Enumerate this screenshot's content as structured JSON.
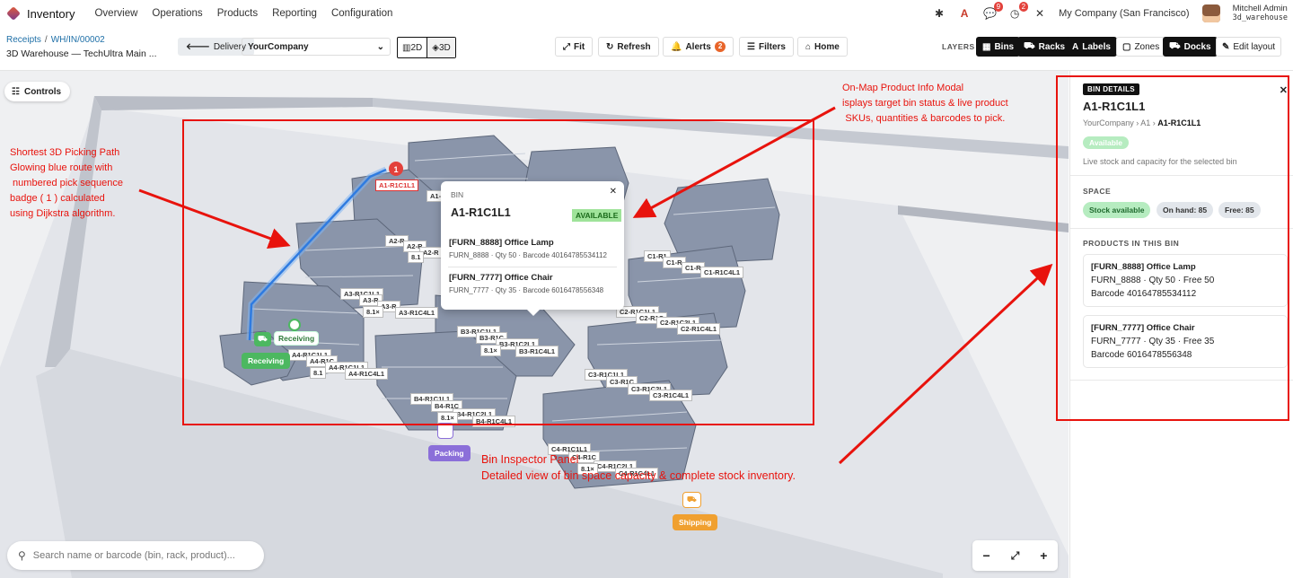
{
  "topbar": {
    "app_name": "Inventory",
    "menu": [
      "Overview",
      "Operations",
      "Products",
      "Reporting",
      "Configuration"
    ],
    "messages_count": "9",
    "activities_count": "2",
    "company": "My Company (San Francisco)",
    "user_name": "Mitchell Admin",
    "database": "3d_warehouse"
  },
  "controlbar": {
    "breadcrumb_parent": "Receipts",
    "breadcrumb_current": "WH/IN/00002",
    "subtitle": "3D Warehouse — TechUltra Main ...",
    "delivery_label": "Delivery",
    "company_select": "YourCompany",
    "view_2d": "2D",
    "view_3d": "3D",
    "fit_label": "Fit",
    "refresh_label": "Refresh",
    "alerts_label": "Alerts",
    "alerts_count": "2",
    "filters_label": "Filters",
    "home_label": "Home",
    "layers_label": "LAYERS",
    "layer_bins": "Bins",
    "layer_racks": "Racks",
    "layer_labels": "Labels",
    "layer_zones": "Zones",
    "layer_docks": "Docks",
    "edit_layout": "Edit layout"
  },
  "canvas": {
    "controls_label": "Controls",
    "search_placeholder": "Search name or barcode (bin, rack, product)...",
    "zoom_out": "−",
    "zoom_fit": "⤢",
    "zoom_in": "+",
    "pick_sequence": "1",
    "highlighted_bin": "A1-R1C1L1",
    "zones": {
      "receiving": "Receiving",
      "packing": "Packing",
      "shipping": "Shipping"
    },
    "rack_labels": {
      "a1_a": "A1-R1C1L1",
      "a1_b": "A1-R",
      "a2_a": "A2-R",
      "a2_b": "A2-R",
      "a2_c": "A2-R",
      "a2_d": "8.1",
      "a3_a": "A3-R1C1L1",
      "a3_b": "A3-R",
      "a3_c": "A3-R",
      "a3_d": "A3-R1C4L1",
      "a3_e": "8.1×",
      "a4_a": "A4-R1C1L1",
      "a4_b": "A4-R1C",
      "a4_c": "A4-R1C1L1",
      "a4_d": "A4-R1C4L1",
      "a4_e": "8.1",
      "b3_a": "B3-R1C1L1",
      "b3_b": "B3-R1C",
      "b3_c": "B3-R1C2L1",
      "b3_d": "B3-R1C4L1",
      "b3_e": "8.1×",
      "b4_a": "B4-R1C1L1",
      "b4_b": "B4-R1C",
      "b4_c": "B4-R1C2L1",
      "b4_d": "B4-R1C4L1",
      "b4_e": "8.1×",
      "c1_a": "C1-R1",
      "c1_b": "C1-R",
      "c1_c": "C1-R",
      "c1_d": "C1-R1C4L1",
      "c2_a": "C2-R1C1L1",
      "c2_b": "C2-R1C",
      "c2_c": "C2-R1C2L1",
      "c2_d": "C2-R1C4L1",
      "c3_a": "C3-R1C1L1",
      "c3_b": "C3-R1C",
      "c3_c": "C3-R1C2L1",
      "c3_d": "C3-R1C4L1",
      "c4_a": "C4-R1C1L1",
      "c4_b": "C4-R1C",
      "c4_c": "C4-R1C2L1",
      "c4_d": "C4-R1C4L1",
      "c4_e": "8.1×"
    }
  },
  "popup": {
    "title": "BIN",
    "bin_code": "A1-R1C1L1",
    "status": "AVAILABLE",
    "products": [
      {
        "name": "[FURN_8888] Office Lamp",
        "meta": "FURN_8888 · Qty 50 · Barcode 40164785534112"
      },
      {
        "name": "[FURN_7777] Office Chair",
        "meta": "FURN_7777 · Qty 35 · Barcode 6016478556348"
      }
    ]
  },
  "panel": {
    "tag": "BIN DETAILS",
    "bin_code": "A1-R1C1L1",
    "crumb_company": "YourCompany",
    "crumb_rack": "A1",
    "crumb_bin": "A1-R1C1L1",
    "status": "Available",
    "description": "Live stock and capacity for the selected bin",
    "space_title": "SPACE",
    "chip_stock": "Stock available",
    "chip_onhand": "On hand: 85",
    "chip_free": "Free: 85",
    "products_title": "PRODUCTS IN THIS BIN",
    "products": [
      {
        "name": "[FURN_8888] Office Lamp",
        "line1": "FURN_8888 · Qty 50 · Free 50",
        "line2": "Barcode 40164785534112"
      },
      {
        "name": "[FURN_7777] Office Chair",
        "line1": "FURN_7777 · Qty 35 · Free 35",
        "line2": "Barcode 6016478556348"
      }
    ]
  },
  "annotations": {
    "path": [
      "Shortest 3D Picking Path",
      "Glowing blue route with",
      " numbered pick sequence",
      "badge ( 1 ) calculated",
      "using Dijkstra algorithm."
    ],
    "modal": [
      "On-Map Product Info Modal",
      "isplays target bin status & live product",
      "SKUs, quantities & barcodes to pick."
    ],
    "inspector": [
      "Bin Inspector Panel",
      "Detailed view of bin space capacity & complete stock inventory."
    ]
  },
  "colors": {
    "receiving": "#4cb860",
    "packing": "#8b6fd9",
    "shipping": "#f0a030",
    "annotation": "#e8130d",
    "path": "#3d8be8",
    "rack": "#8793a8"
  }
}
